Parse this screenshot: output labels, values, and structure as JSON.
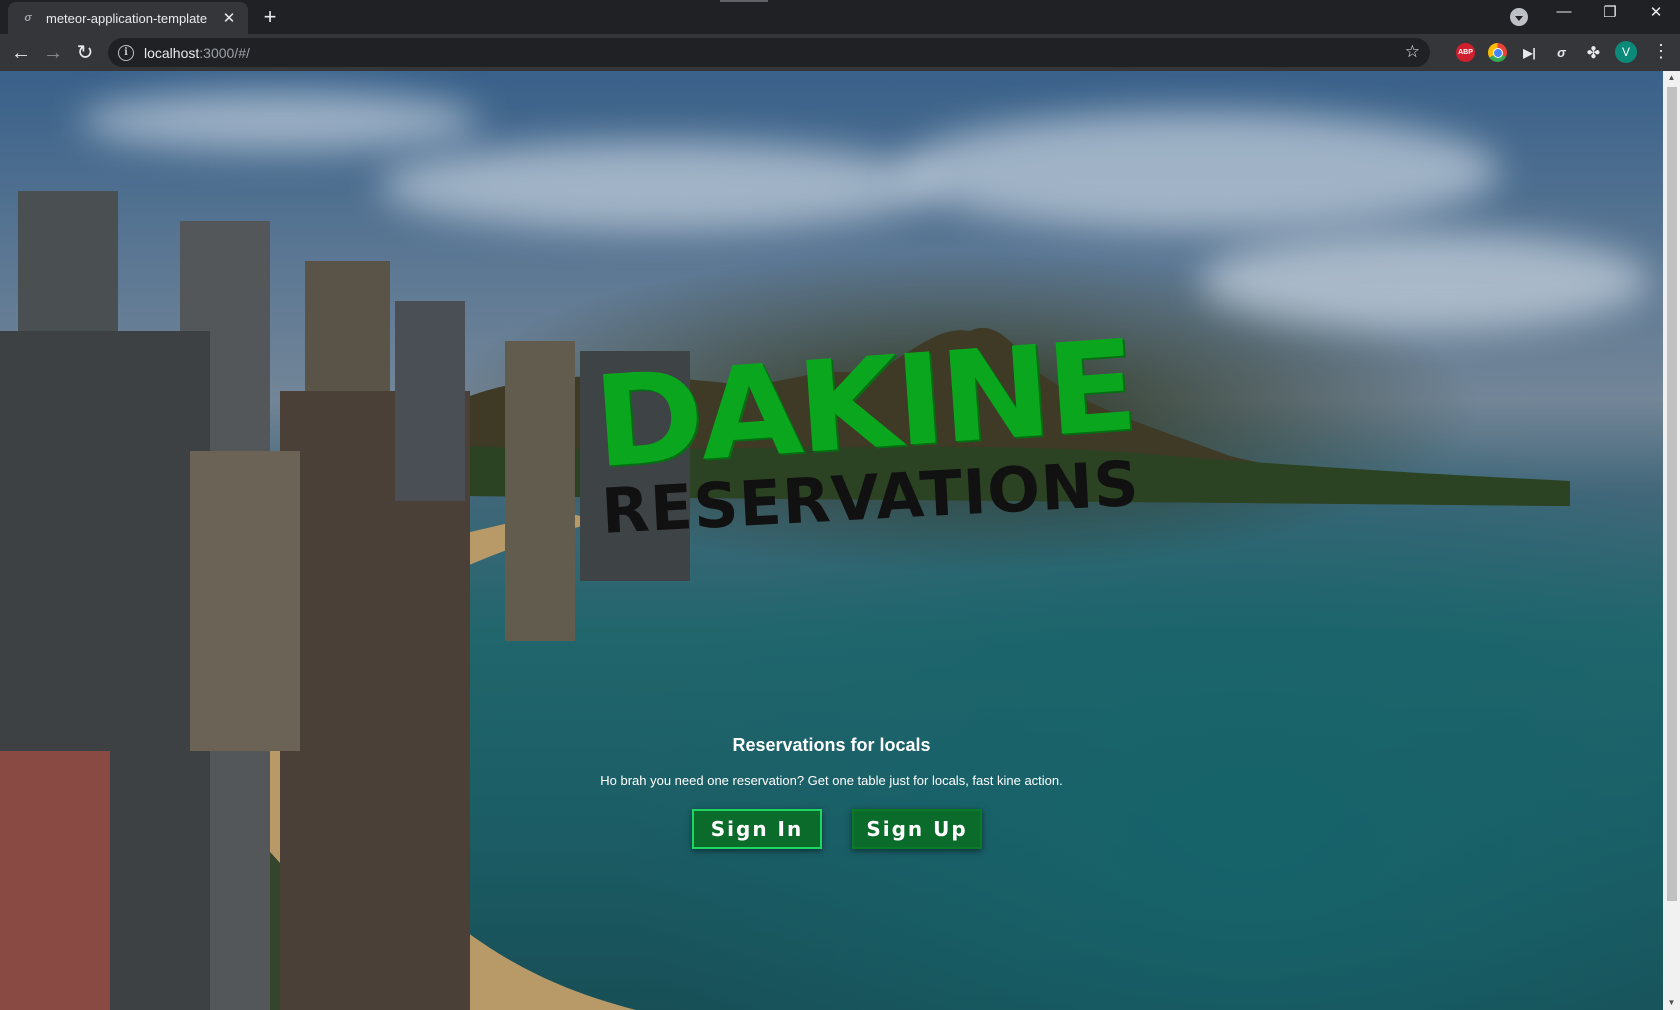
{
  "browser": {
    "tab_title": "meteor-application-template",
    "favicon_glyph": "σ",
    "close_glyph": "✕",
    "new_tab_glyph": "+",
    "url_host": "localhost",
    "url_path": ":3000/#/",
    "info_glyph": "i",
    "back_glyph": "←",
    "forward_glyph": "→",
    "reload_glyph": "↻",
    "star_glyph": "☆",
    "minimize_glyph": "—",
    "restore_glyph": "❐",
    "window_close_glyph": "✕",
    "extensions": {
      "abp_label": "ABP",
      "skip_glyph": "▶|",
      "meteor_glyph": "σ",
      "puzzle_glyph": "✤",
      "avatar_letter": "V"
    },
    "menu_glyph": "⋮",
    "icons": [
      "search-tabs-icon",
      "back-arrow-icon",
      "forward-arrow-icon",
      "reload-icon",
      "info-icon",
      "star-icon",
      "adblock-icon",
      "color-picker-icon",
      "skip-icon",
      "meteor-devtools-icon",
      "extensions-puzzle-icon",
      "profile-avatar",
      "menu-icon"
    ]
  },
  "hero": {
    "logo_top": "DAKINE",
    "logo_bottom": "RESERVATIONS",
    "subtitle": "Reservations for locals",
    "tagline": "Ho brah you need one reservation? Get one table just for locals, fast kine action.",
    "signin_label": "Sign In",
    "signup_label": "Sign Up"
  },
  "colors": {
    "logo_green": "#0aa71e",
    "logo_black": "#111111",
    "button_bg": "#0a6b2a",
    "button_border": "#15b04a",
    "chrome_dark": "#202124",
    "chrome_toolbar": "#35363a"
  },
  "scrollbar": {
    "up_glyph": "▲",
    "down_glyph": "▼"
  }
}
